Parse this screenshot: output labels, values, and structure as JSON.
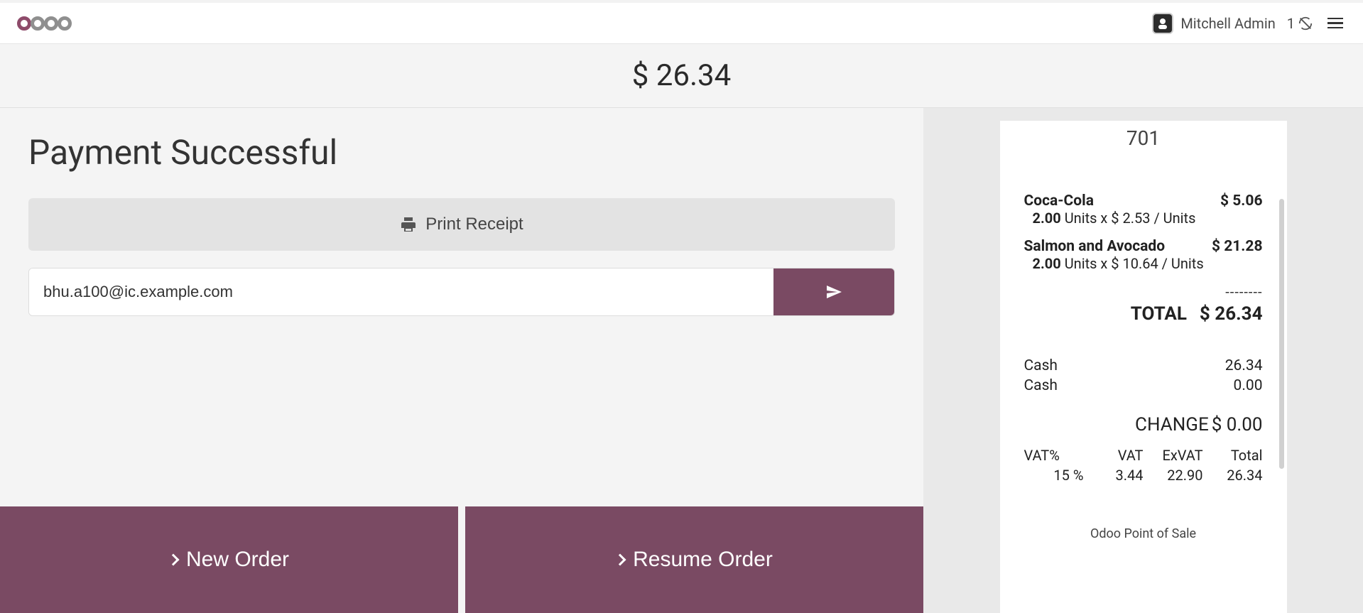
{
  "colors": {
    "accent": "#7a4a63"
  },
  "header": {
    "user_name": "Mitchell Admin",
    "sync_count": "1"
  },
  "amount": "$ 26.34",
  "status_title": "Payment Successful",
  "print_label": "Print Receipt",
  "email_value": "bhu.a100@ic.example.com",
  "buttons": {
    "new_order": "New Order",
    "resume_order": "Resume Order"
  },
  "receipt": {
    "number": "701",
    "items": [
      {
        "name": "Coca-Cola",
        "price": "$ 5.06",
        "qty": "2.00",
        "unit_line": "Units x $ 2.53 / Units"
      },
      {
        "name": "Salmon and Avocado",
        "price": "$ 21.28",
        "qty": "2.00",
        "unit_line": "Units x $ 10.64 / Units"
      }
    ],
    "total_label": "TOTAL",
    "total_value": "$ 26.34",
    "payments": [
      {
        "method": "Cash",
        "value": "26.34"
      },
      {
        "method": "Cash",
        "value": "0.00"
      }
    ],
    "change_label": "CHANGE",
    "change_value": "$ 0.00",
    "tax_headers": [
      "VAT%",
      "VAT",
      "ExVAT",
      "Total"
    ],
    "tax_row": [
      "15 %",
      "3.44",
      "22.90",
      "26.34"
    ],
    "footer": "Odoo Point of Sale"
  }
}
